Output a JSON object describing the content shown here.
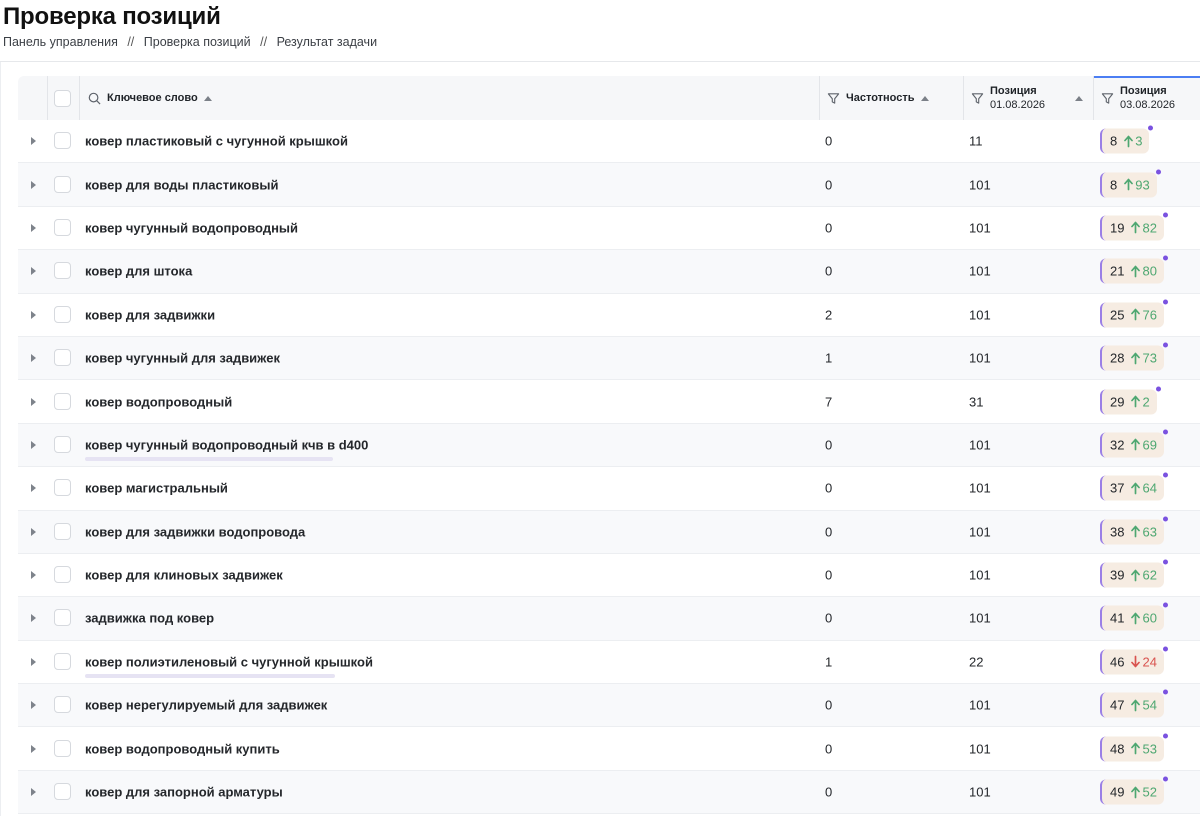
{
  "page": {
    "title": "Проверка позиций",
    "breadcrumb": [
      "Панель управления",
      "//",
      "Проверка позиций",
      "//",
      "Результат задачи"
    ]
  },
  "table": {
    "headers": {
      "keyword": "Ключевое слово",
      "frequency": "Частотность",
      "pos1_label": "Позиция",
      "pos1_date": "01.08.2026",
      "pos2_label": "Позиция",
      "pos2_date": "03.08.2026"
    },
    "icons": {
      "search": "search-icon",
      "filter": "filter-icon",
      "expand": "expand-icon",
      "arrow_up": "arrow-up-icon",
      "arrow_down": "arrow-down-icon"
    },
    "colors": {
      "delta_up": "#4ea771",
      "delta_down": "#d9534f",
      "badge_bg": "#f6ece2",
      "badge_accent": "#9a7fe6",
      "active_column": "#4b7ef3"
    },
    "rows": [
      {
        "keyword": "ковер пластиковый с чугунной крышкой",
        "frequency": "0",
        "pos1": "11",
        "pos2": "8",
        "delta": "3",
        "dir": "up"
      },
      {
        "keyword": "ковер для воды пластиковый",
        "frequency": "0",
        "pos1": "101",
        "pos2": "8",
        "delta": "93",
        "dir": "up"
      },
      {
        "keyword": "ковер чугунный водопроводный",
        "frequency": "0",
        "pos1": "101",
        "pos2": "19",
        "delta": "82",
        "dir": "up"
      },
      {
        "keyword": "ковер для штока",
        "frequency": "0",
        "pos1": "101",
        "pos2": "21",
        "delta": "80",
        "dir": "up"
      },
      {
        "keyword": "ковер для задвижки",
        "frequency": "2",
        "pos1": "101",
        "pos2": "25",
        "delta": "76",
        "dir": "up"
      },
      {
        "keyword": "ковер чугунный для задвижек",
        "frequency": "1",
        "pos1": "101",
        "pos2": "28",
        "delta": "73",
        "dir": "up"
      },
      {
        "keyword": "ковер водопроводный",
        "frequency": "7",
        "pos1": "31",
        "pos2": "29",
        "delta": "2",
        "dir": "up"
      },
      {
        "keyword": "ковер чугунный водопроводный кчв в d400",
        "frequency": "0",
        "pos1": "101",
        "pos2": "32",
        "delta": "69",
        "dir": "up",
        "underline": true
      },
      {
        "keyword": "ковер магистральный",
        "frequency": "0",
        "pos1": "101",
        "pos2": "37",
        "delta": "64",
        "dir": "up"
      },
      {
        "keyword": "ковер для задвижки водопровода",
        "frequency": "0",
        "pos1": "101",
        "pos2": "38",
        "delta": "63",
        "dir": "up"
      },
      {
        "keyword": "ковер для клиновых задвижек",
        "frequency": "0",
        "pos1": "101",
        "pos2": "39",
        "delta": "62",
        "dir": "up"
      },
      {
        "keyword": "задвижка под ковер",
        "frequency": "0",
        "pos1": "101",
        "pos2": "41",
        "delta": "60",
        "dir": "up"
      },
      {
        "keyword": "ковер полиэтиленовый с чугунной крышкой",
        "frequency": "1",
        "pos1": "22",
        "pos2": "46",
        "delta": "24",
        "dir": "down",
        "underline": true
      },
      {
        "keyword": "ковер нерегулируемый для задвижек",
        "frequency": "0",
        "pos1": "101",
        "pos2": "47",
        "delta": "54",
        "dir": "up"
      },
      {
        "keyword": "ковер водопроводный купить",
        "frequency": "0",
        "pos1": "101",
        "pos2": "48",
        "delta": "53",
        "dir": "up"
      },
      {
        "keyword": "ковер для запорной арматуры",
        "frequency": "0",
        "pos1": "101",
        "pos2": "49",
        "delta": "52",
        "dir": "up"
      }
    ]
  }
}
